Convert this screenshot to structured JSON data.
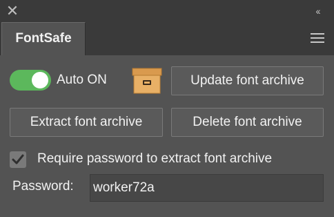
{
  "titlebar": {
    "close_glyph": "✕",
    "collapse_glyph": "‹‹"
  },
  "tabs": [
    {
      "label": "FontSafe",
      "active": true
    }
  ],
  "menu_icon": "hamburger-menu-icon",
  "toggle": {
    "label": "Auto ON",
    "on": true,
    "on_color": "#5cb85c"
  },
  "archive_icon": "archive-box-icon",
  "buttons": {
    "update": "Update font archive",
    "extract": "Extract font archive",
    "delete": "Delete font archive"
  },
  "require_password": {
    "label": "Require password to extract font archive",
    "checked": true
  },
  "password": {
    "label": "Password:",
    "value": "worker72a"
  },
  "colors": {
    "panel_bg": "#535353",
    "header_bg": "#3a3a3a",
    "text": "#f2f2f2"
  }
}
